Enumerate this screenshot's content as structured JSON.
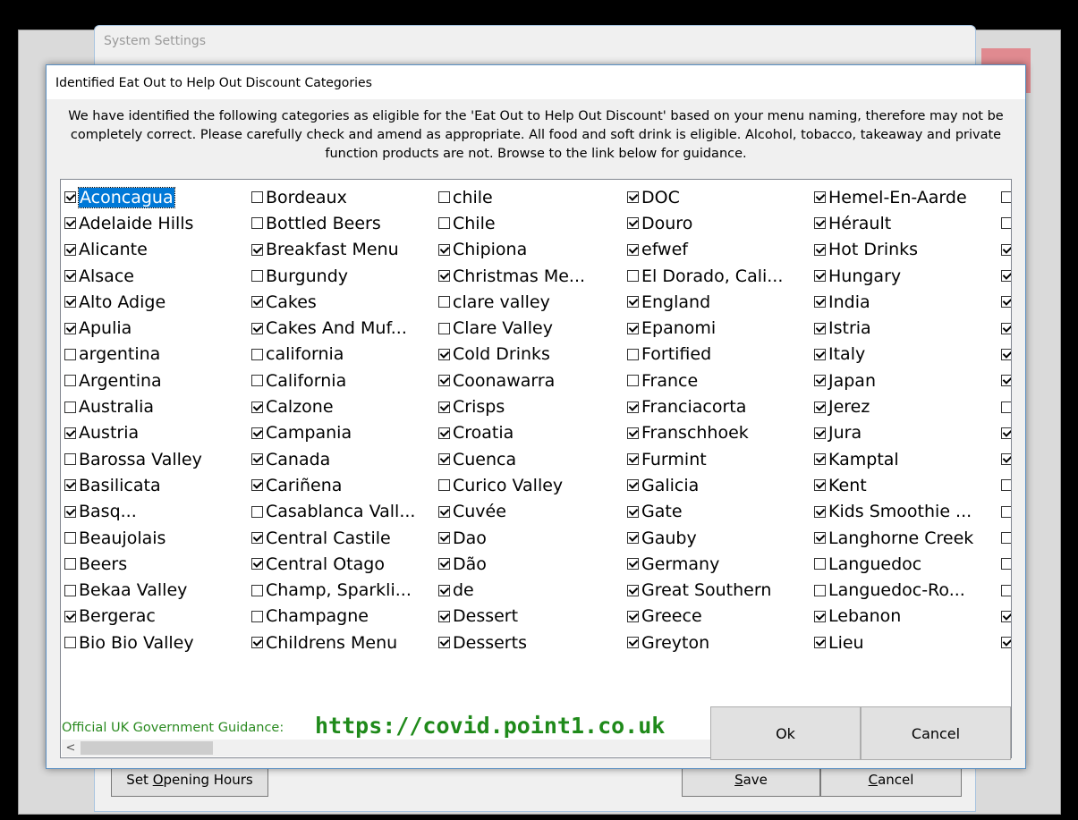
{
  "background_window": {
    "title": "System Settings",
    "buttons": {
      "opening_hours": "Set Opening Hours",
      "opening_hours_mnemonic": "O",
      "save": "Save",
      "save_mnemonic": "S",
      "cancel": "Cancel",
      "cancel_mnemonic": "C"
    }
  },
  "dialog": {
    "title": "Identified Eat Out to Help Out Discount Categories",
    "description": "We have identified the following categories as eligible for the 'Eat Out to Help Out Discount' based on your menu naming, therefore may not be completely correct. Please carefully check and amend as appropriate. All food and soft drink is eligible. Alcohol, tobacco, takeaway and private function products are not. Browse to the link below for guidance.",
    "guidance_label": "Official UK Government Guidance:",
    "guidance_link": "https://covid.point1.co.uk",
    "ok_label": "Ok",
    "cancel_label": "Cancel",
    "columns": [
      [
        {
          "label": "Aconcagua",
          "checked": true,
          "selected": true
        },
        {
          "label": "Adelaide Hills",
          "checked": true
        },
        {
          "label": "Alicante",
          "checked": true
        },
        {
          "label": "Alsace",
          "checked": true
        },
        {
          "label": "Alto Adige",
          "checked": true
        },
        {
          "label": "Apulia",
          "checked": true
        },
        {
          "label": "argentina",
          "checked": false
        },
        {
          "label": "Argentina",
          "checked": false
        },
        {
          "label": "Australia",
          "checked": false
        },
        {
          "label": "Austria",
          "checked": true
        },
        {
          "label": "Barossa Valley",
          "checked": false
        },
        {
          "label": "Basilicata",
          "checked": true
        },
        {
          "label": "Basq...",
          "checked": true
        },
        {
          "label": "Beaujolais",
          "checked": false
        },
        {
          "label": "Beers",
          "checked": false
        },
        {
          "label": "Bekaa Valley",
          "checked": false
        },
        {
          "label": "Bergerac",
          "checked": true
        },
        {
          "label": "Bio Bio Valley",
          "checked": false
        }
      ],
      [
        {
          "label": "Bordeaux",
          "checked": false
        },
        {
          "label": "Bottled Beers",
          "checked": false
        },
        {
          "label": "Breakfast Menu",
          "checked": true
        },
        {
          "label": "Burgundy",
          "checked": false
        },
        {
          "label": "Cakes",
          "checked": true
        },
        {
          "label": "Cakes And Muf...",
          "checked": true
        },
        {
          "label": "california",
          "checked": false
        },
        {
          "label": "California",
          "checked": false
        },
        {
          "label": "Calzone",
          "checked": true
        },
        {
          "label": "Campania",
          "checked": true
        },
        {
          "label": "Canada",
          "checked": true
        },
        {
          "label": "Cariñena",
          "checked": true
        },
        {
          "label": "Casablanca Vall...",
          "checked": false
        },
        {
          "label": "Central Castile",
          "checked": true
        },
        {
          "label": "Central Otago",
          "checked": true
        },
        {
          "label": "Champ, Sparkli...",
          "checked": false
        },
        {
          "label": "Champagne",
          "checked": false
        },
        {
          "label": "Childrens Menu",
          "checked": true
        }
      ],
      [
        {
          "label": "chile",
          "checked": false
        },
        {
          "label": "Chile",
          "checked": false
        },
        {
          "label": "Chipiona",
          "checked": true
        },
        {
          "label": "Christmas Me...",
          "checked": true
        },
        {
          "label": "clare valley",
          "checked": false
        },
        {
          "label": "Clare Valley",
          "checked": false
        },
        {
          "label": "Cold Drinks",
          "checked": true
        },
        {
          "label": "Coonawarra",
          "checked": true
        },
        {
          "label": "Crisps",
          "checked": true
        },
        {
          "label": "Croatia",
          "checked": true
        },
        {
          "label": "Cuenca",
          "checked": true
        },
        {
          "label": "Curico Valley",
          "checked": false
        },
        {
          "label": "Cuvée",
          "checked": true
        },
        {
          "label": "Dao",
          "checked": true
        },
        {
          "label": "Dão",
          "checked": true
        },
        {
          "label": "de",
          "checked": true
        },
        {
          "label": "Dessert",
          "checked": true
        },
        {
          "label": "Desserts",
          "checked": true
        }
      ],
      [
        {
          "label": "DOC",
          "checked": true
        },
        {
          "label": "Douro",
          "checked": true
        },
        {
          "label": "efwef",
          "checked": true
        },
        {
          "label": "El Dorado, Cali...",
          "checked": false
        },
        {
          "label": "England",
          "checked": true
        },
        {
          "label": "Epanomi",
          "checked": true
        },
        {
          "label": "Fortified",
          "checked": false
        },
        {
          "label": "France",
          "checked": false
        },
        {
          "label": "Franciacorta",
          "checked": true
        },
        {
          "label": "Franschhoek",
          "checked": true
        },
        {
          "label": "Furmint",
          "checked": true
        },
        {
          "label": "Galicia",
          "checked": true
        },
        {
          "label": "Gate",
          "checked": true
        },
        {
          "label": "Gauby",
          "checked": true
        },
        {
          "label": "Germany",
          "checked": true
        },
        {
          "label": "Great Southern",
          "checked": true
        },
        {
          "label": "Greece",
          "checked": true
        },
        {
          "label": "Greyton",
          "checked": true
        }
      ],
      [
        {
          "label": "Hemel-En-Aarde",
          "checked": true
        },
        {
          "label": "Hérault",
          "checked": true
        },
        {
          "label": "Hot Drinks",
          "checked": true
        },
        {
          "label": "Hungary",
          "checked": true
        },
        {
          "label": "India",
          "checked": true
        },
        {
          "label": "Istria",
          "checked": true
        },
        {
          "label": "Italy",
          "checked": true
        },
        {
          "label": "Japan",
          "checked": true
        },
        {
          "label": "Jerez",
          "checked": true
        },
        {
          "label": "Jura",
          "checked": true
        },
        {
          "label": "Kamptal",
          "checked": true
        },
        {
          "label": "Kent",
          "checked": true
        },
        {
          "label": "Kids Smoothie ...",
          "checked": true
        },
        {
          "label": "Langhorne Creek",
          "checked": true
        },
        {
          "label": "Languedoc",
          "checked": false
        },
        {
          "label": "Languedoc-Ro...",
          "checked": false
        },
        {
          "label": "Lebanon",
          "checked": true
        },
        {
          "label": "Lieu",
          "checked": true
        }
      ],
      [
        {
          "label": "",
          "checked": false
        },
        {
          "label": "",
          "checked": false
        },
        {
          "label": "",
          "checked": true
        },
        {
          "label": "",
          "checked": true
        },
        {
          "label": "",
          "checked": true
        },
        {
          "label": "",
          "checked": true
        },
        {
          "label": "",
          "checked": true
        },
        {
          "label": "",
          "checked": true
        },
        {
          "label": "",
          "checked": false
        },
        {
          "label": "",
          "checked": true
        },
        {
          "label": "",
          "checked": true
        },
        {
          "label": "",
          "checked": false
        },
        {
          "label": "",
          "checked": false
        },
        {
          "label": "",
          "checked": false
        },
        {
          "label": "",
          "checked": false
        },
        {
          "label": "",
          "checked": false
        },
        {
          "label": "",
          "checked": true
        },
        {
          "label": "",
          "checked": true
        }
      ]
    ]
  },
  "scrollbar": {
    "left_arrow": "<",
    "right_arrow": ">"
  }
}
